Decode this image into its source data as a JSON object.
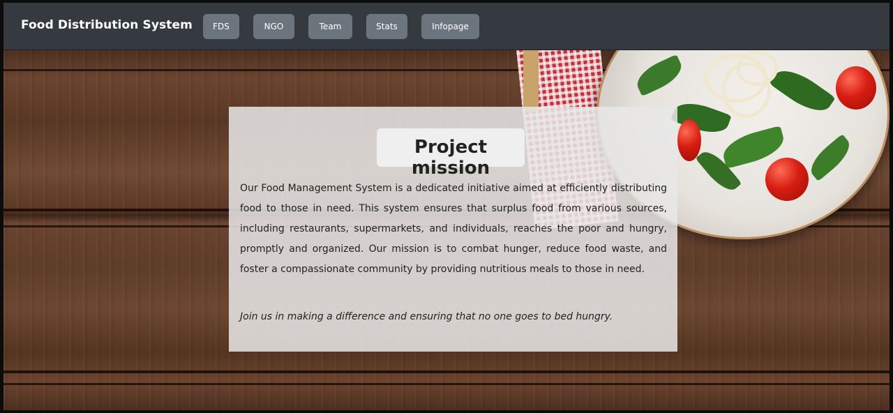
{
  "navbar": {
    "brand": "Food Distribution System",
    "items": [
      {
        "label": "FDS"
      },
      {
        "label": "NGO"
      },
      {
        "label": "Team"
      },
      {
        "label": "Stats"
      },
      {
        "label": "Infopage"
      }
    ],
    "background_color": "#343a40",
    "button_color": "#6c757d"
  },
  "mission": {
    "title": "Project mission",
    "body": "Our Food Management System is a dedicated initiative aimed at efficiently distributing food to those in need. This system ensures that surplus food from various sources, including restaurants, supermarkets, and individuals, reaches the poor and hungry, promptly and organized. Our mission is to combat hunger, reduce food waste, and foster a compassionate community by providing nutritious meals to those in need.",
    "call_to_action": "Join us in making a difference and ensuring that no one goes to bed hungry."
  },
  "background": {
    "image_semantic": "wooden-table-with-salad-plate"
  }
}
